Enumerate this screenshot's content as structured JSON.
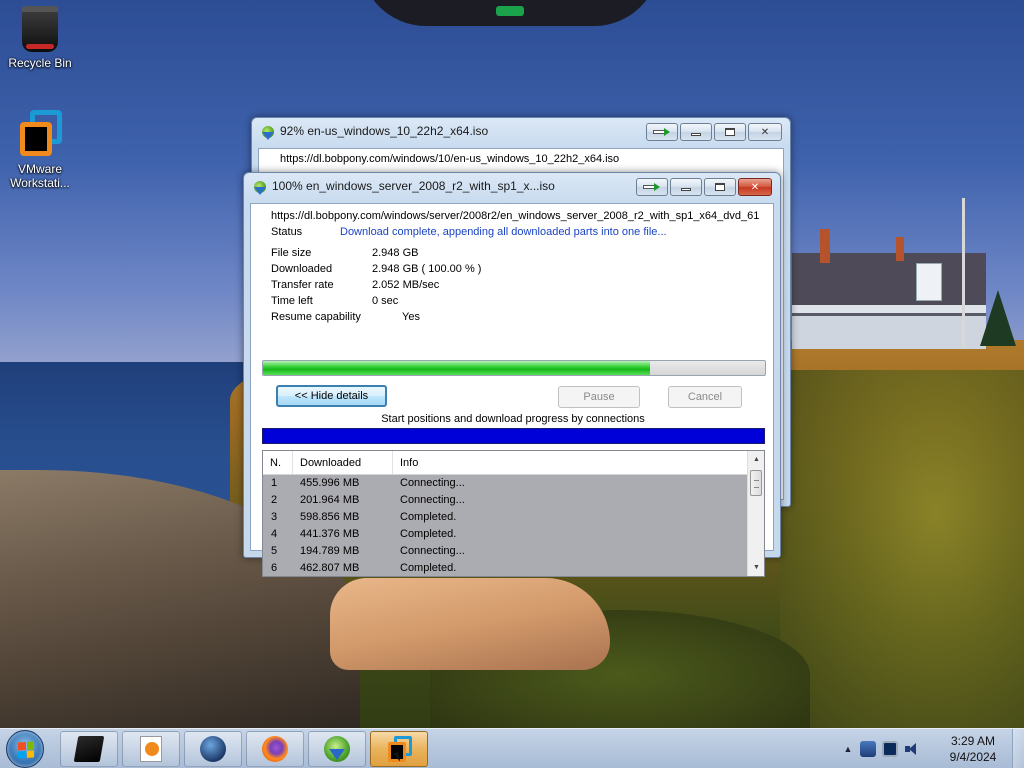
{
  "desktop": {
    "icons": [
      {
        "label": "Recycle Bin",
        "icon": "recycle-bin-icon"
      },
      {
        "label": "VMware Workstati...",
        "icon": "vmware-workstation-icon"
      }
    ]
  },
  "window_back": {
    "title": "92% en-us_windows_10_22h2_x64.iso",
    "url": "https://dl.bobpony.com/windows/10/en-us_windows_10_22h2_x64.iso"
  },
  "window_front": {
    "title": "100% en_windows_server_2008_r2_with_sp1_x...iso",
    "url": "https://dl.bobpony.com/windows/server/2008r2/en_windows_server_2008_r2_with_sp1_x64_dvd_61",
    "status_label": "Status",
    "status_value": "Download complete, appending all downloaded parts into one file...",
    "fields": {
      "file_size_label": "File size",
      "file_size_value": "2.948  GB",
      "downloaded_label": "Downloaded",
      "downloaded_value": "2.948  GB  ( 100.00 % )",
      "transfer_rate_label": "Transfer rate",
      "transfer_rate_value": "2.052  MB/sec",
      "time_left_label": "Time left",
      "time_left_value": "0 sec",
      "resume_label": "Resume capability",
      "resume_value": "Yes"
    },
    "progress_fraction": 0.77,
    "buttons": {
      "hide_details": "<< Hide details",
      "pause": "Pause",
      "cancel": "Cancel"
    },
    "connections_caption": "Start positions and download progress by connections",
    "table": {
      "headers": [
        "N.",
        "Downloaded",
        "Info"
      ],
      "rows": [
        {
          "n": "1",
          "downloaded": "455.996  MB",
          "info": "Connecting..."
        },
        {
          "n": "2",
          "downloaded": "201.964  MB",
          "info": "Connecting..."
        },
        {
          "n": "3",
          "downloaded": "598.856  MB",
          "info": "Completed."
        },
        {
          "n": "4",
          "downloaded": "441.376  MB",
          "info": "Completed."
        },
        {
          "n": "5",
          "downloaded": "194.789  MB",
          "info": "Connecting..."
        },
        {
          "n": "6",
          "downloaded": "462.807  MB",
          "info": "Completed."
        }
      ]
    }
  },
  "taskbar": {
    "pinned": [
      {
        "icon": "virtualbox-icon"
      },
      {
        "icon": "media-player-icon"
      },
      {
        "icon": "globe-icon"
      },
      {
        "icon": "firefox-icon"
      },
      {
        "icon": "internet-download-manager-icon"
      },
      {
        "icon": "vmware-workstation-icon",
        "active": true
      }
    ],
    "tray_icons": [
      "show-hidden-icons-icon",
      "network-icon",
      "display-icon",
      "volume-icon"
    ],
    "clock_time": "3:29 AM",
    "clock_date": "9/4/2024"
  },
  "colors": {
    "progress_green": "#17b817",
    "connection_bar_blue": "#0000d8",
    "status_text_blue": "#1a44c4",
    "close_button_red": "#c5381f"
  }
}
